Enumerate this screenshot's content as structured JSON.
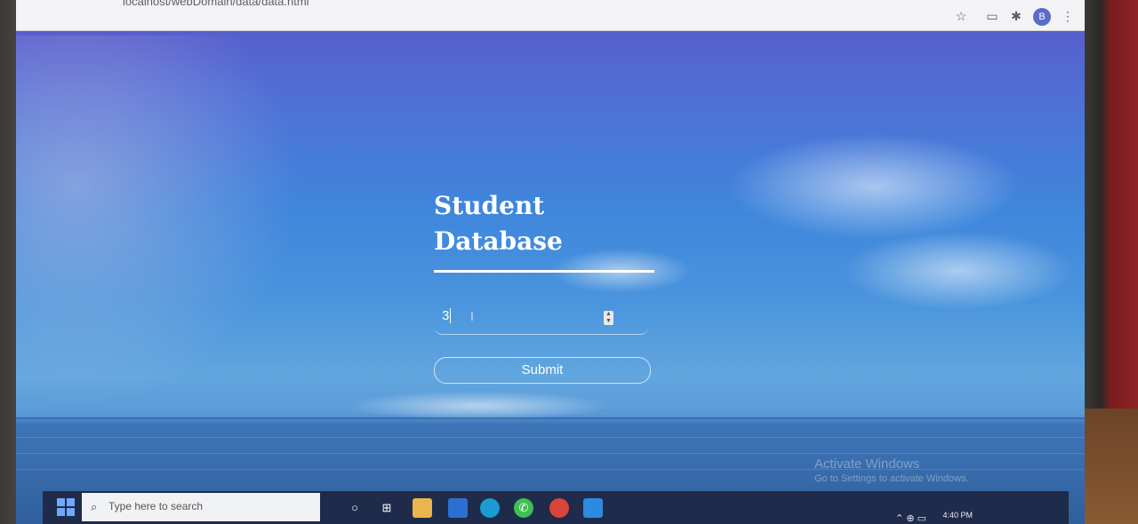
{
  "browser": {
    "url": "localhost/webDomain/data/data.html",
    "profile_initial": "B",
    "icons": [
      "star-icon",
      "cast-icon",
      "extensions-icon",
      "menu-icon"
    ]
  },
  "form": {
    "title_line1": "Student",
    "title_line2": "Database",
    "number_value": "3",
    "submit_label": "Submit"
  },
  "watermark": {
    "title": "Activate Windows",
    "subtitle": "Go to Settings to activate Windows."
  },
  "taskbar": {
    "search_placeholder": "Type here to search",
    "time": "4:40 PM",
    "apps": [
      "cortana-icon",
      "task-view-icon",
      "file-explorer-icon",
      "store-icon",
      "edge-icon",
      "whatsapp-icon",
      "chrome-icon",
      "vscode-icon"
    ]
  },
  "colors": {
    "sky_top": "#5a56c8",
    "sky_mid": "#3f86dc",
    "sea": "#2f5f9c",
    "taskbar": "#1f2b4a"
  }
}
